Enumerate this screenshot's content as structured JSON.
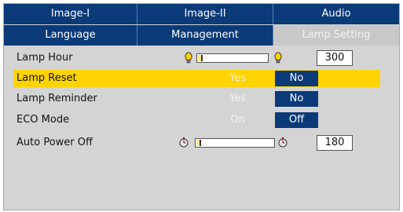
{
  "tabs_row1": [
    {
      "label": "Image-I"
    },
    {
      "label": "Image-II"
    },
    {
      "label": "Audio"
    }
  ],
  "tabs_row2": [
    {
      "label": "Language"
    },
    {
      "label": "Management"
    },
    {
      "label": "Lamp Setting"
    }
  ],
  "settings": {
    "lamp_hour": {
      "label": "Lamp Hour",
      "value": "300",
      "slider_fraction": 0.03
    },
    "lamp_reset": {
      "label": "Lamp Reset",
      "yes": "Yes",
      "no": "No",
      "selected": "No"
    },
    "lamp_reminder": {
      "label": "Lamp Reminder",
      "yes": "Yes",
      "no": "No",
      "selected": "No"
    },
    "eco_mode": {
      "label": "ECO Mode",
      "on": "On",
      "off": "Off",
      "selected": "Off"
    },
    "auto_power_off": {
      "label": "Auto Power Off",
      "value": "180",
      "slider_fraction": 0.02
    }
  },
  "colors": {
    "tab_active": "#0a3a78",
    "tab_inactive": "#c8c8c8",
    "highlight": "#ffd400",
    "panel": "#d4d4d4"
  },
  "icons": {
    "lamp_low": "bulb-dim-icon",
    "lamp_high": "bulb-bright-icon",
    "timer_low": "timer-icon",
    "timer_high": "timer-icon"
  }
}
